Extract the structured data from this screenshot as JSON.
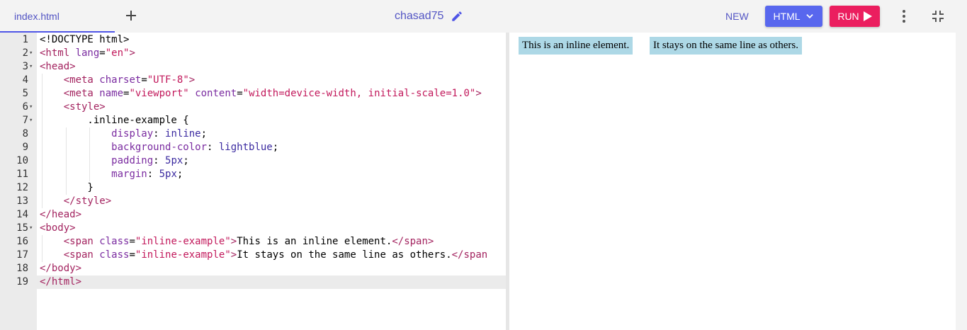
{
  "tabs": [
    {
      "label": "index.html"
    }
  ],
  "project": {
    "name": "chasad75"
  },
  "toolbar": {
    "new_label": "NEW",
    "language_label": "HTML",
    "run_label": "RUN"
  },
  "editor": {
    "lines": [
      {
        "num": "1",
        "fold": "",
        "tokens": [
          [
            "t-plain",
            "<!DOCTYPE html>"
          ]
        ]
      },
      {
        "num": "2",
        "fold": "▾",
        "tokens": [
          [
            "t-tag",
            "<html "
          ],
          [
            "t-attr",
            "lang"
          ],
          [
            "t-plain",
            "="
          ],
          [
            "t-str",
            "\"en\""
          ],
          [
            "t-tag",
            ">"
          ]
        ]
      },
      {
        "num": "3",
        "fold": "▾",
        "tokens": [
          [
            "t-tag",
            "<head>"
          ]
        ]
      },
      {
        "num": "4",
        "fold": "",
        "tokens": [
          [
            "t-plain",
            "    "
          ],
          [
            "t-tag",
            "<meta "
          ],
          [
            "t-attr",
            "charset"
          ],
          [
            "t-plain",
            "="
          ],
          [
            "t-str",
            "\"UTF-8\""
          ],
          [
            "t-tag",
            ">"
          ]
        ]
      },
      {
        "num": "5",
        "fold": "",
        "tokens": [
          [
            "t-plain",
            "    "
          ],
          [
            "t-tag",
            "<meta "
          ],
          [
            "t-attr",
            "name"
          ],
          [
            "t-plain",
            "="
          ],
          [
            "t-str",
            "\"viewport\""
          ],
          [
            "t-plain",
            " "
          ],
          [
            "t-attr",
            "content"
          ],
          [
            "t-plain",
            "="
          ],
          [
            "t-str",
            "\"width=device-width, initial-scale=1.0\""
          ],
          [
            "t-tag",
            ">"
          ]
        ]
      },
      {
        "num": "6",
        "fold": "▾",
        "tokens": [
          [
            "t-plain",
            "    "
          ],
          [
            "t-tag",
            "<style>"
          ]
        ]
      },
      {
        "num": "7",
        "fold": "▾",
        "tokens": [
          [
            "t-plain",
            "        .inline-example {"
          ]
        ]
      },
      {
        "num": "8",
        "fold": "",
        "tokens": [
          [
            "t-plain",
            "            "
          ],
          [
            "t-attr",
            "display"
          ],
          [
            "t-plain",
            ": "
          ],
          [
            "t-val",
            "inline"
          ],
          [
            "t-plain",
            ";"
          ]
        ]
      },
      {
        "num": "9",
        "fold": "",
        "tokens": [
          [
            "t-plain",
            "            "
          ],
          [
            "t-attr",
            "background-color"
          ],
          [
            "t-plain",
            ": "
          ],
          [
            "t-val",
            "lightblue"
          ],
          [
            "t-plain",
            ";"
          ]
        ]
      },
      {
        "num": "10",
        "fold": "",
        "tokens": [
          [
            "t-plain",
            "            "
          ],
          [
            "t-attr",
            "padding"
          ],
          [
            "t-plain",
            ": "
          ],
          [
            "t-val",
            "5px"
          ],
          [
            "t-plain",
            ";"
          ]
        ]
      },
      {
        "num": "11",
        "fold": "",
        "tokens": [
          [
            "t-plain",
            "            "
          ],
          [
            "t-attr",
            "margin"
          ],
          [
            "t-plain",
            ": "
          ],
          [
            "t-val",
            "5px"
          ],
          [
            "t-plain",
            ";"
          ]
        ]
      },
      {
        "num": "12",
        "fold": "",
        "tokens": [
          [
            "t-plain",
            "        }"
          ]
        ]
      },
      {
        "num": "13",
        "fold": "",
        "tokens": [
          [
            "t-plain",
            "    "
          ],
          [
            "t-tag",
            "</style>"
          ]
        ]
      },
      {
        "num": "14",
        "fold": "",
        "tokens": [
          [
            "t-tag",
            "</head>"
          ]
        ]
      },
      {
        "num": "15",
        "fold": "▾",
        "tokens": [
          [
            "t-tag",
            "<body>"
          ]
        ]
      },
      {
        "num": "16",
        "fold": "",
        "tokens": [
          [
            "t-plain",
            "    "
          ],
          [
            "t-tag",
            "<span "
          ],
          [
            "t-attr",
            "class"
          ],
          [
            "t-plain",
            "="
          ],
          [
            "t-str",
            "\"inline-example\""
          ],
          [
            "t-tag",
            ">"
          ],
          [
            "t-plain",
            "This is an inline element."
          ],
          [
            "t-tag",
            "</span>"
          ]
        ]
      },
      {
        "num": "17",
        "fold": "",
        "tokens": [
          [
            "t-plain",
            "    "
          ],
          [
            "t-tag",
            "<span "
          ],
          [
            "t-attr",
            "class"
          ],
          [
            "t-plain",
            "="
          ],
          [
            "t-str",
            "\"inline-example\""
          ],
          [
            "t-tag",
            ">"
          ],
          [
            "t-plain",
            "It stays on the same line as others."
          ],
          [
            "t-tag",
            "</span"
          ]
        ]
      },
      {
        "num": "18",
        "fold": "",
        "tokens": [
          [
            "t-tag",
            "</body>"
          ]
        ]
      },
      {
        "num": "19",
        "fold": "",
        "tokens": [
          [
            "t-tag",
            "</html>"
          ]
        ]
      }
    ]
  },
  "preview": {
    "spans": [
      "This is an inline element.",
      "It stays on the same line as others."
    ]
  }
}
